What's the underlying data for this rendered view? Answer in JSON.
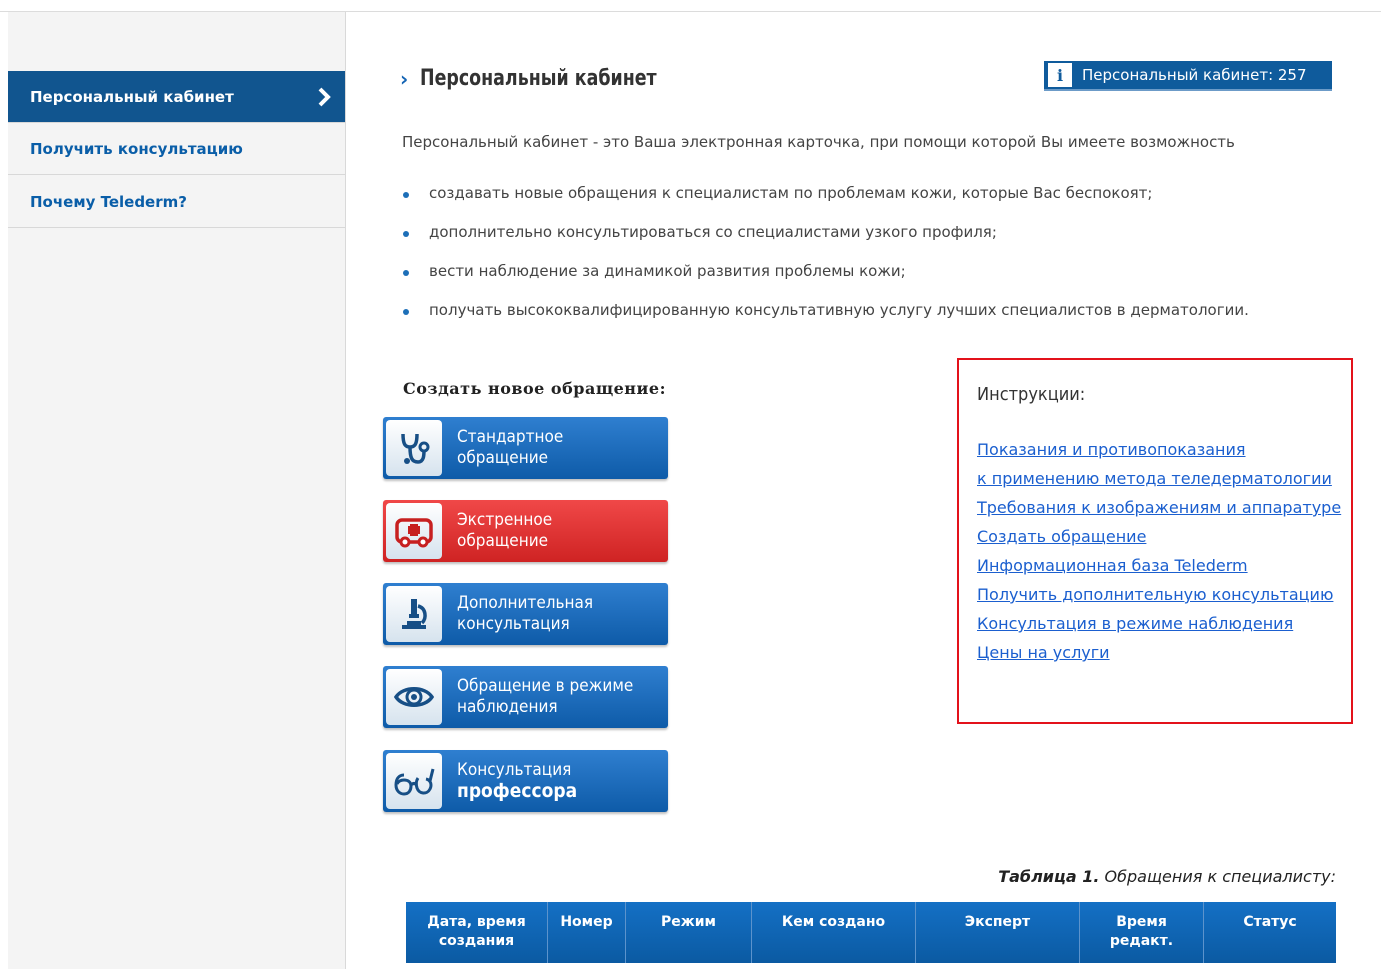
{
  "sidebar": {
    "items": [
      {
        "label": "Персональный кабинет",
        "active": true
      },
      {
        "label": "Получить консультацию"
      },
      {
        "label": "Почему Telederm?"
      }
    ]
  },
  "header": {
    "title": "Персональный кабинет",
    "badge": {
      "icon": "info-icon",
      "text": "Персональный кабинет: 257"
    }
  },
  "intro": {
    "text": "Персональный кабинет - это Ваша электронная карточка, при помощи которой Вы имеете возможность",
    "bullets": [
      "создавать новые обращения к специалистам по проблемам кожи, которые Вас беспокоят;",
      "дополнительно консультироваться со специалистами узкого профиля;",
      "вести наблюдение за динамикой развития проблемы кожи;",
      "получать высококвалифицированную консультативную услугу лучших специалистов в дерматологии."
    ]
  },
  "create": {
    "label": "Создать новое обращение:",
    "buttons": [
      {
        "line1": "Стандартное",
        "line2": "обращение",
        "icon": "stethoscope-icon"
      },
      {
        "line1": "Экстренное",
        "line2": "обращение",
        "icon": "ambulance-icon"
      },
      {
        "line1": "Дополнительная",
        "line2": "консультация",
        "icon": "microscope-icon"
      },
      {
        "line1": "Обращение в режиме",
        "line2": "наблюдения",
        "icon": "eye-icon"
      },
      {
        "line1": "Консультация",
        "line2": "профессора",
        "icon": "glasses-icon"
      }
    ]
  },
  "instructions": {
    "title": "Инструкции:",
    "links": [
      "Показания и противопоказания",
      "к применению метода теледерматологии",
      "Требования к изображениям и аппаратуре",
      "Создать обращение",
      "Информационная база Telederm",
      "Получить дополнительную консультацию",
      "Консультация в режиме наблюдения",
      "Цены на услуги"
    ]
  },
  "table": {
    "caption_bold": "Таблица 1.",
    "caption_text": " Обращения к специалисту:",
    "headers": [
      {
        "l1": "Дата, время",
        "l2": "создания"
      },
      {
        "l1": "Номер",
        "l2": ""
      },
      {
        "l1": "Режим",
        "l2": ""
      },
      {
        "l1": "Кем создано",
        "l2": ""
      },
      {
        "l1": "Эксперт",
        "l2": ""
      },
      {
        "l1": "Время",
        "l2": "редакт."
      },
      {
        "l1": "Статус",
        "l2": ""
      }
    ]
  },
  "colors": {
    "accent": "#0f5b9c",
    "emergency": "#e12d2d",
    "link": "#1b5fcf",
    "frame": "#e3121b"
  }
}
